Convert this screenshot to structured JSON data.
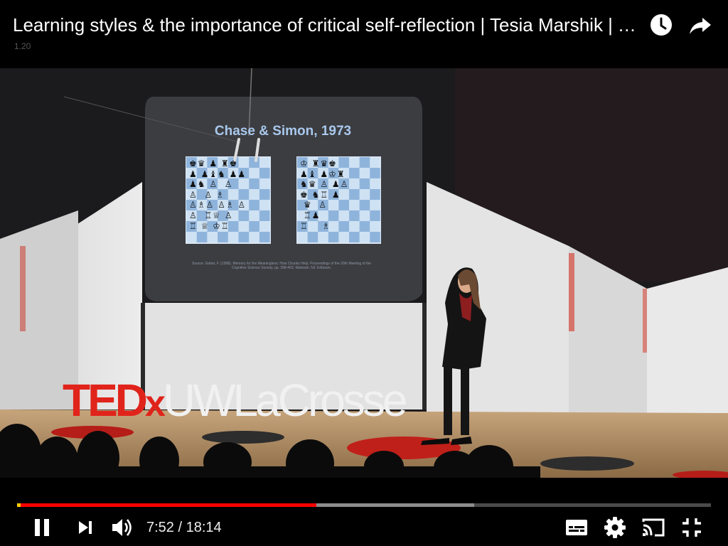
{
  "player": {
    "title": "Learning styles & the importance of critical self-reflection | Tesia Marshik | TEDxUWLaCrosse",
    "speed": "1.20",
    "top_icons": [
      "watch-later-icon",
      "share-icon"
    ]
  },
  "video_frame": {
    "slide_title": "Chase & Simon, 1973",
    "slide_footnote": "Source: Gobet, F. (1998). Memory for the Meaningless: How Chunks Help. Proceedings of the 20th Meeting of the Cognitive Science Society, pp. 398-403. Mahwah, NJ: Erlbaum.",
    "board_left": "♚♛ ♟ ♜♚\n♟ ♟♝♞ ♟♟\n♟♞ ♙  ♙\n♙  ♙ ♗\n♙♗♙ ♙♗ ♙\n♙  ♖♕ ♙\n♖ ♕ ♔♖",
    "board_right": "♔ ♜♛♚\n♟♝ ♟♔♜\n♞♛ ♙ ♟♙\n♚ ♞♖ ♟\n ♛  ♙\n ♖♟\n♖    ♗",
    "logo_ted": "TED",
    "logo_x": "x",
    "logo_venue": "UWLaCrosse"
  },
  "controls": {
    "current_time": "7:52",
    "duration": "18:14",
    "time_separator": " / ",
    "progress_played_fraction": 0.431,
    "progress_buffered_fraction": 0.659,
    "left_icons": [
      "pause-icon",
      "next-icon",
      "volume-icon"
    ],
    "right_icons": [
      "subtitles-icon",
      "settings-icon",
      "cast-icon",
      "exit-fullscreen-icon"
    ]
  },
  "colors": {
    "played": "#ff0000",
    "buffered": "#8c8c8c",
    "track": "#4a4a4a",
    "ted_red": "#e0241b"
  }
}
